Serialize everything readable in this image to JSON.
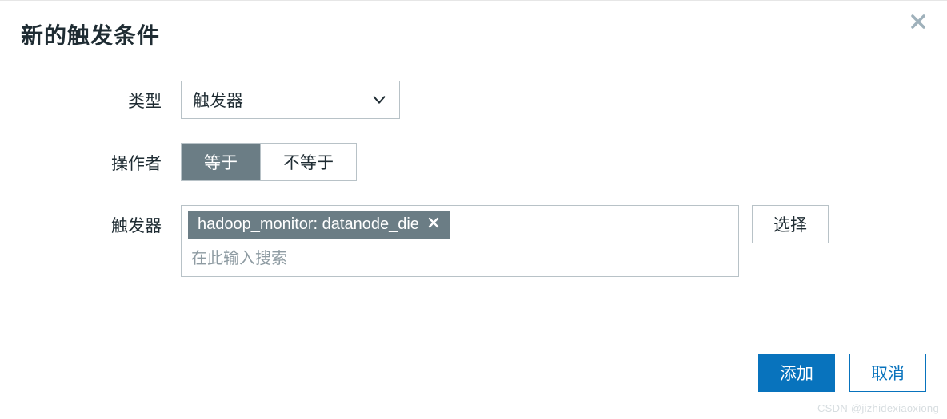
{
  "dialog": {
    "title": "新的触发条件"
  },
  "form": {
    "type": {
      "label": "类型",
      "value": "触发器"
    },
    "operator": {
      "label": "操作者",
      "options": [
        "等于",
        "不等于"
      ],
      "selected": "等于"
    },
    "trigger": {
      "label": "触发器",
      "tag": "hadoop_monitor: datanode_die",
      "placeholder": "在此输入搜索",
      "select_button": "选择"
    }
  },
  "footer": {
    "add": "添加",
    "cancel": "取消"
  },
  "watermark": "CSDN @jizhidexiaoxiong"
}
